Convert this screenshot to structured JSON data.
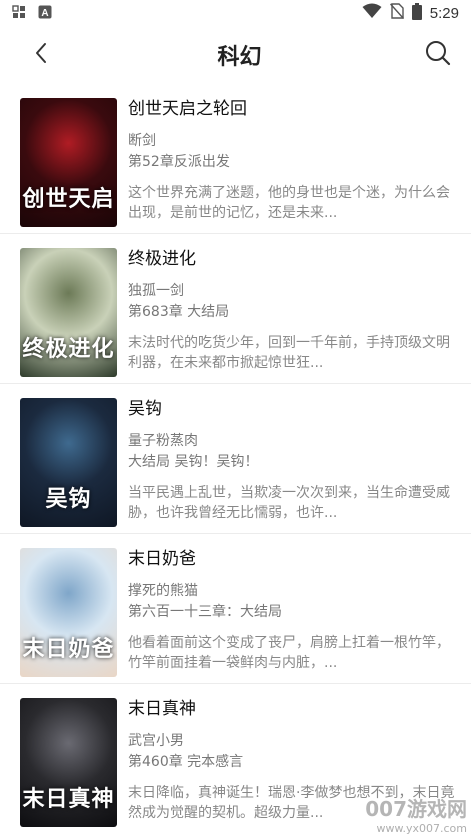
{
  "status_bar": {
    "time": "5:29",
    "icons": [
      "notification-grid-icon",
      "a-letter-icon",
      "wifi-icon",
      "no-sim-icon",
      "battery-icon"
    ]
  },
  "header": {
    "title": "科幻",
    "back_icon": "chevron-left-icon",
    "search_icon": "search-icon"
  },
  "books": [
    {
      "title": "创世天启之轮回",
      "author": "断剑",
      "chapter": "第52章反派出发",
      "description": "这个世界充满了迷题，他的身世也是个迷，为什么会出现，是前世的记忆，还是未来...",
      "cover_text": "创世天启",
      "cover_colors": [
        "#3a0a0e",
        "#b01c24",
        "#1a0507"
      ]
    },
    {
      "title": "终极进化",
      "author": "独孤一剑",
      "chapter": "第683章 大结局",
      "description": "末法时代的吃货少年，回到一千年前，手持顶级文明利器，在未来都市掀起惊世狂...",
      "cover_text": "终极进化",
      "cover_colors": [
        "#c9d1b8",
        "#6c7a57",
        "#2d3a2a"
      ]
    },
    {
      "title": "吴钩",
      "author": "量子粉蒸肉",
      "chapter": "大结局 吴钩！吴钩！",
      "description": "当平民遇上乱世，当欺凌一次次到来，当生命遭受威胁，也许我曾经无比懦弱，也许...",
      "cover_text": "吴钩",
      "cover_colors": [
        "#1b2a3f",
        "#3f6a8f",
        "#0f1724"
      ]
    },
    {
      "title": "末日奶爸",
      "author": "撑死的熊猫",
      "chapter": "第六百一十三章：大结局",
      "description": "他看着面前这个变成了丧尸，肩膀上扛着一根竹竿，竹竿前面挂着一袋鲜肉与内脏，...",
      "cover_text": "末日奶爸",
      "cover_colors": [
        "#d7e6f2",
        "#7fa6c9",
        "#e9d6c6"
      ]
    },
    {
      "title": "末日真神",
      "author": "武宫小男",
      "chapter": "第460章 完本感言",
      "description": "末日降临，真神诞生！瑞恩·李做梦也想不到，末日竟然成为觉醒的契机。超级力量...",
      "cover_text": "末日真神",
      "cover_colors": [
        "#2a2a2e",
        "#6a6a72",
        "#0d0d10"
      ]
    }
  ],
  "watermark": {
    "main": "007游戏网",
    "sub": "www.yx007.com"
  }
}
